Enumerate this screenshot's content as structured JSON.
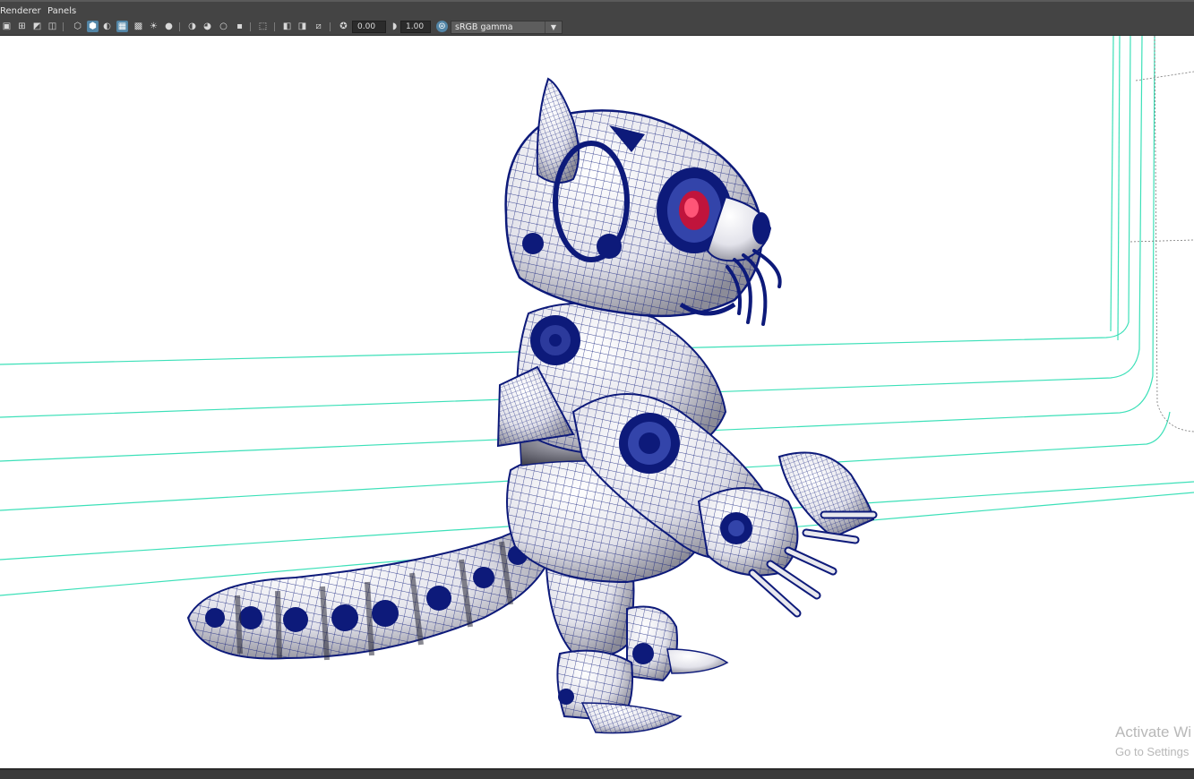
{
  "menubar": {
    "items": [
      {
        "label": "Renderer"
      },
      {
        "label": "Panels"
      }
    ]
  },
  "toolbar": {
    "icons": [
      "select-camera-icon",
      "camera-attributes-icon",
      "bookmark-icon",
      "image-plane-icon",
      "wireframe-icon",
      "smooth-shade-icon",
      "default-material-icon",
      "wireframe-on-shaded-icon",
      "textured-icon",
      "use-all-lights-icon",
      "shadows-icon",
      "screen-space-ao-icon",
      "motion-blur-icon",
      "anti-aliasing-icon",
      "depth-of-field-icon",
      "isolate-select-icon",
      "xray-icon",
      "xray-active-components-icon",
      "xray-joints-icon",
      "backface-culling-icon",
      "gate-mask-icon",
      "exposure-icon",
      "gamma-icon",
      "color-management-icon"
    ],
    "exposure_value": "0.00",
    "gamma_value": "1.00",
    "color_space": "sRGB gamma",
    "dropdown_arrow": "▼"
  },
  "viewport": {
    "model": "wireframe-on-shaded robot lemur character",
    "wireframe_color": "#0d1a7a",
    "grid_color": "#3ce0b8",
    "eye_color": "#c0143c",
    "background": "#ffffff"
  },
  "watermark": {
    "line1": "Activate Wi",
    "line2": "Go to Settings"
  }
}
